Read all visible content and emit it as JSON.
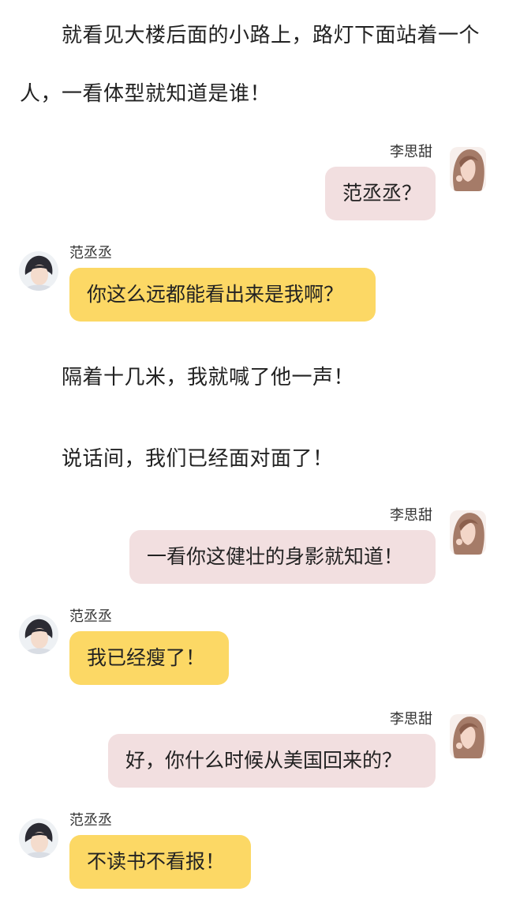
{
  "narration": [
    "就看见大楼后面的小路上，路灯下面站着一个",
    "人，一看体型就知道是谁！",
    "隔着十几米，我就喊了他一声！",
    "说话间，我们已经面对面了！"
  ],
  "participants": {
    "right_name": "李思甜",
    "left_name": "范丞丞",
    "right_avatar_icon": "girl-avatar-icon",
    "left_avatar_icon": "boy-avatar-icon"
  },
  "colors": {
    "right_bubble": "#f2dfe0",
    "left_bubble": "#fcd865",
    "background": "#ffffff"
  },
  "messages": [
    {
      "side": "right",
      "name": "李思甜",
      "text": "范丞丞？"
    },
    {
      "side": "left",
      "name": "范丞丞",
      "text": "你这么远都能看出来是我啊？"
    },
    {
      "side": "right",
      "name": "李思甜",
      "text": "一看你这健壮的身影就知道！"
    },
    {
      "side": "left",
      "name": "范丞丞",
      "text": "我已经瘦了！"
    },
    {
      "side": "right",
      "name": "李思甜",
      "text": "好，你什么时候从美国回来的？"
    },
    {
      "side": "left",
      "name": "范丞丞",
      "text": "不读书不看报！"
    }
  ]
}
